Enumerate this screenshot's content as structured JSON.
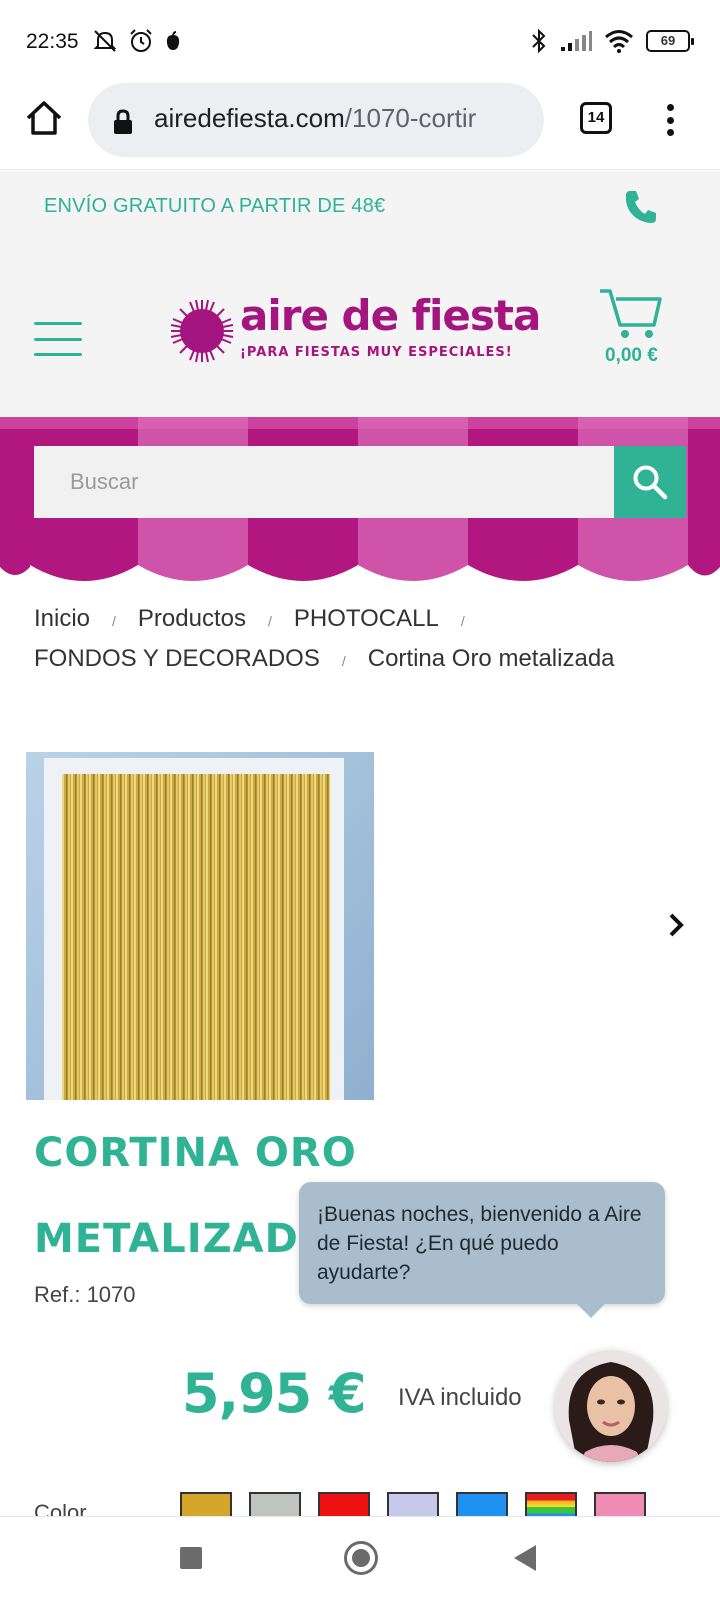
{
  "status_bar": {
    "time": "22:35",
    "battery": "69",
    "icons_left": [
      "mute-icon",
      "alarm-icon",
      "notification-icon"
    ],
    "icons_right": [
      "bluetooth-icon",
      "signal-icon",
      "wifi-icon",
      "battery-icon"
    ]
  },
  "browser": {
    "url_host": "airedefiesta.com",
    "url_path": "/1070-cortir",
    "tab_count": "14"
  },
  "promo": {
    "shipping_text": "ENVÍO GRATUITO A PARTIR DE 48€"
  },
  "header": {
    "logo_name": "aire de fiesta",
    "logo_tagline": "¡PARA FIESTAS MUY ESPECIALES!",
    "cart_total": "0,00 €"
  },
  "search": {
    "placeholder": "Buscar"
  },
  "breadcrumb": {
    "items": [
      "Inicio",
      "Productos",
      "PHOTOCALL",
      "FONDOS Y DECORADOS",
      "Cortina Oro metalizada"
    ],
    "separator": "/"
  },
  "product": {
    "title": "CORTINA ORO METALIZADA",
    "ref": "Ref.: 1070",
    "price": "5,95 €",
    "tax_note": "IVA incluido",
    "colors_label": "Color",
    "color_swatches": [
      "#d4a72c",
      "#c0c4c0",
      "#ee1111",
      "#c8c8ec",
      "#1e90f0",
      "rainbow",
      "#f08cb4"
    ]
  },
  "chat": {
    "message": "¡Buenas noches, bienvenido a Aire de Fiesta! ¿En qué puedo ayudarte?"
  },
  "colors": {
    "brand_green": "#2fb394",
    "brand_magenta": "#a5157f",
    "awning_pink": "#c2389a",
    "chat_bubble": "#aabdcc"
  }
}
